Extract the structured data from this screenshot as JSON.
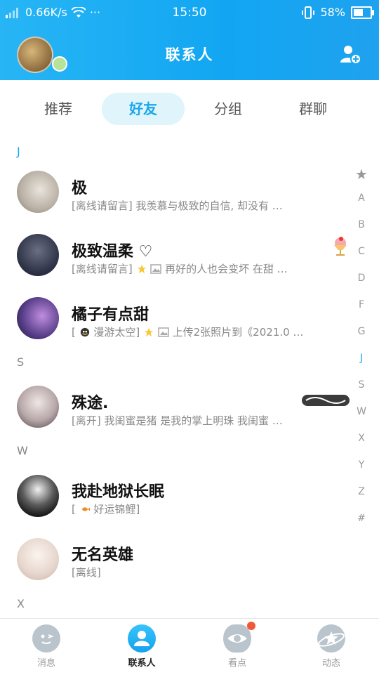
{
  "status": {
    "speed": "0.66K/s",
    "dots": "···",
    "time": "15:50",
    "battery": "58%",
    "battery_fraction": 0.58
  },
  "header": {
    "title": "联系人"
  },
  "tabs": [
    {
      "label": "推荐"
    },
    {
      "label": "好友"
    },
    {
      "label": "分组"
    },
    {
      "label": "群聊"
    }
  ],
  "active_tab": "好友",
  "sections": {
    "j": "J",
    "s": "S",
    "w": "W",
    "x": "X"
  },
  "contacts": [
    {
      "name": "极",
      "message": "[离线请留言] 我羡慕与极致的自信, 却没有 …"
    },
    {
      "name": "极致温柔 ♡",
      "message_prefix": "[离线请留言]",
      "message": "再好的人也会变坏 在甜 …"
    },
    {
      "name": "橘子有点甜",
      "message_prefix": "[",
      "status_text": "漫游太空]",
      "message": "上传2张照片到《2021.0 …"
    },
    {
      "name": "殊途.",
      "message": "[离开] 我闺蜜是猪 是我的掌上明珠 我闺蜜 …"
    },
    {
      "name": "我赴地狱长眠",
      "message_prefix": "[",
      "message": "好运锦鲤]"
    },
    {
      "name": "无名英雄",
      "message": "[离线]"
    }
  ],
  "index_bar": [
    "★",
    "A",
    "B",
    "C",
    "D",
    "F",
    "G",
    "J",
    "S",
    "W",
    "X",
    "Y",
    "Z",
    "#"
  ],
  "index_active": "J",
  "nav": [
    {
      "label": "消息",
      "icon": "message-icon"
    },
    {
      "label": "联系人",
      "icon": "contacts-icon"
    },
    {
      "label": "看点",
      "icon": "eye-icon"
    },
    {
      "label": "动态",
      "icon": "planet-icon"
    }
  ],
  "colors": {
    "accent": "#1aa7ec",
    "header": "#12a6f2",
    "badge": "#f25836"
  }
}
